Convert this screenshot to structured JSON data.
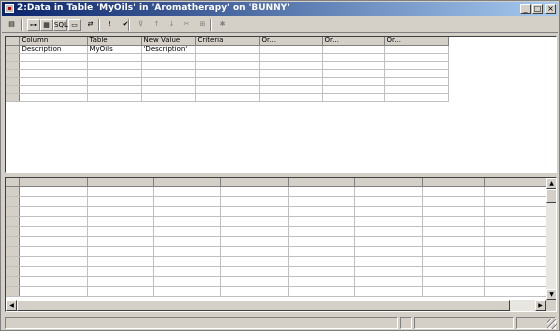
{
  "window": {
    "title": "2:Data in Table 'MyOils' in 'Aromatherapy' on 'BUNNY'",
    "controls": {
      "minimize": "_",
      "restore": "□",
      "close": "×"
    }
  },
  "toolbar": {
    "buttons": [
      {
        "name": "query-type-icon",
        "glyph": "▤"
      },
      {
        "name": "show-diagram-icon",
        "glyph": "⊶"
      },
      {
        "name": "show-grid-icon",
        "glyph": "▦"
      },
      {
        "name": "show-sql-button",
        "glyph": "SQL"
      },
      {
        "name": "show-results-icon",
        "glyph": "▭"
      },
      {
        "name": "change-type-icon",
        "glyph": "⇄"
      },
      {
        "name": "run-icon",
        "glyph": "!"
      },
      {
        "name": "verify-sql-icon",
        "glyph": "✔"
      },
      {
        "name": "remove-filter-icon",
        "glyph": "⊽"
      },
      {
        "name": "sort-ascending-icon",
        "glyph": "↑"
      },
      {
        "name": "sort-descending-icon",
        "glyph": "↓"
      },
      {
        "name": "remove-sort-icon",
        "glyph": "✂"
      },
      {
        "name": "add-table-icon",
        "glyph": "⊞"
      },
      {
        "name": "new-row-icon",
        "glyph": "✱"
      }
    ]
  },
  "criteria_grid": {
    "columns": [
      "Column",
      "Table",
      "New Value",
      "Criteria",
      "Or...",
      "Or...",
      "Or..."
    ],
    "rows": [
      [
        "Description",
        "MyOils",
        "'Description'",
        "",
        "",
        "",
        ""
      ],
      [
        "",
        "",
        "",
        "",
        "",
        "",
        ""
      ],
      [
        "",
        "",
        "",
        "",
        "",
        "",
        ""
      ],
      [
        "",
        "",
        "",
        "",
        "",
        "",
        ""
      ],
      [
        "",
        "",
        "",
        "",
        "",
        "",
        ""
      ],
      [
        "",
        "",
        "",
        "",
        "",
        "",
        ""
      ],
      [
        "",
        "",
        "",
        "",
        "",
        "",
        ""
      ]
    ]
  },
  "results_grid": {
    "columns": [
      "",
      "",
      "",
      "",
      "",
      "",
      "",
      "",
      ""
    ],
    "row_count": 11
  },
  "scroll": {
    "up": "▲",
    "down": "▼",
    "left": "◀",
    "right": "▶"
  }
}
